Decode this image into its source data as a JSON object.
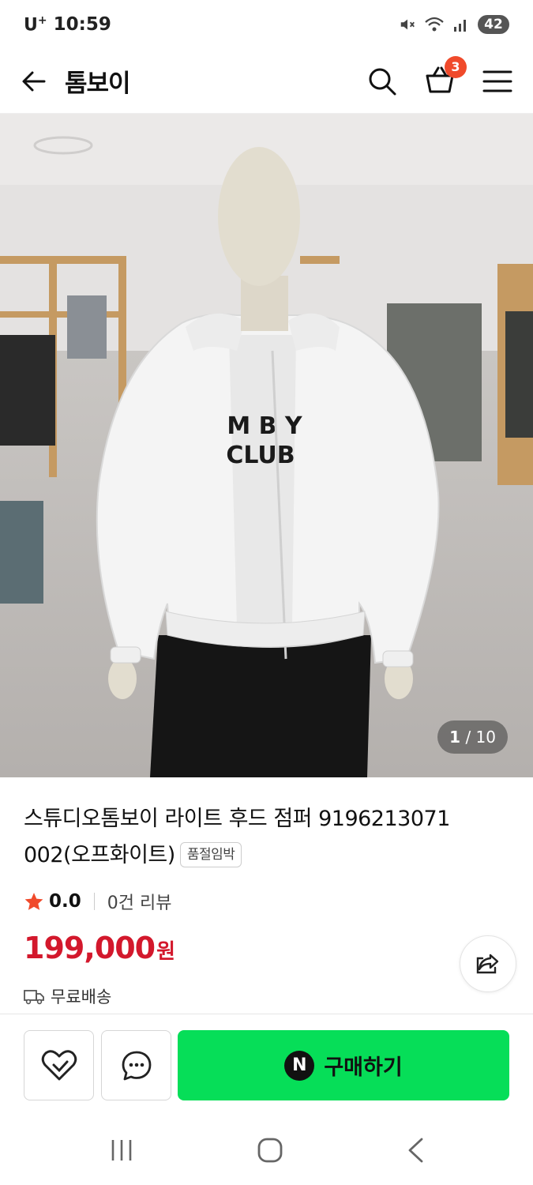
{
  "status_bar": {
    "carrier": "U",
    "carrier_sup": "+",
    "time": "10:59",
    "battery": "42"
  },
  "header": {
    "title": "톰보이",
    "cart_count": "3"
  },
  "product_image": {
    "counter_current": "1",
    "counter_sep": " / ",
    "counter_total": "10",
    "tee_print_line1": "M B Y",
    "tee_print_line2": "CLUB"
  },
  "product": {
    "name": "스튜디오톰보이 라이트 후드 점퍼 9196213071 002(오프화이트)",
    "soldout_badge": "품절임박",
    "rating": "0.0",
    "review_count": "0건 리뷰",
    "price": "199,000",
    "currency": "원",
    "shipping": "무료배송"
  },
  "bottom_bar": {
    "buy_label": "구매하기",
    "buy_logo": "N"
  },
  "colors": {
    "price": "#d3182c",
    "buy_button": "#06de58",
    "badge": "#f04a2b",
    "star": "#f04a2b"
  },
  "icons": [
    "back-arrow-icon",
    "search-icon",
    "cart-icon",
    "menu-icon",
    "star-icon",
    "share-icon",
    "truck-icon",
    "heart-icon",
    "chat-icon",
    "recent-apps-icon",
    "home-icon",
    "back-icon"
  ]
}
